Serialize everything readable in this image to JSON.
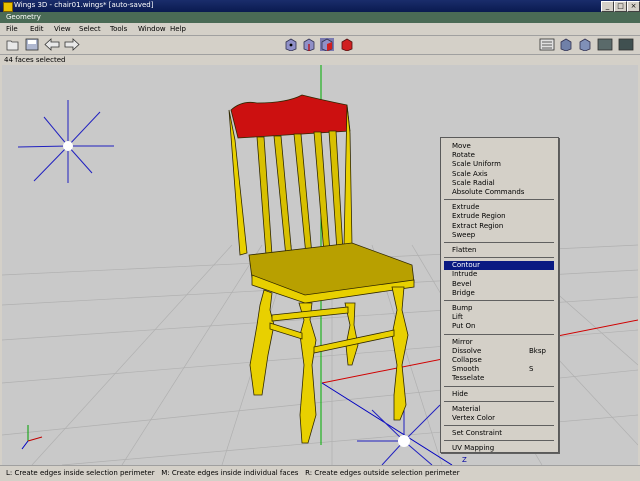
{
  "window": {
    "title": "Wings 3D - chair01.wings* [auto-saved]",
    "controls": {
      "minimize": "_",
      "maximize": "□",
      "close": "×"
    }
  },
  "geometry_bar": {
    "label": "Geometry"
  },
  "menubar": {
    "items": [
      "File",
      "Edit",
      "View",
      "Select",
      "Tools",
      "Window",
      "Help"
    ]
  },
  "toolbar": {
    "left_icons": [
      "open-file-icon",
      "save-icon",
      "undo-arrow-icon",
      "redo-arrow-icon"
    ],
    "mode_icons": [
      "vertex-mode-icon",
      "edge-mode-icon",
      "face-mode-icon",
      "body-mode-icon"
    ],
    "right_icons": [
      "orthographic-icon",
      "smooth-shade-icon",
      "wireframe-icon",
      "ground-plane-icon",
      "axes-icon"
    ]
  },
  "status": {
    "selection": "44 faces selected"
  },
  "context_menu": {
    "groups": [
      [
        {
          "label": "Move"
        },
        {
          "label": "Rotate"
        },
        {
          "label": "Scale Uniform"
        },
        {
          "label": "Scale Axis"
        },
        {
          "label": "Scale Radial"
        },
        {
          "label": "Absolute Commands"
        }
      ],
      [
        {
          "label": "Extrude"
        },
        {
          "label": "Extrude Region"
        },
        {
          "label": "Extract Region"
        },
        {
          "label": "Sweep"
        }
      ],
      [
        {
          "label": "Flatten"
        }
      ],
      [
        {
          "label": "Contour",
          "selected": true
        },
        {
          "label": "Intrude"
        },
        {
          "label": "Bevel"
        },
        {
          "label": "Bridge"
        }
      ],
      [
        {
          "label": "Bump"
        },
        {
          "label": "Lift"
        },
        {
          "label": "Put On"
        }
      ],
      [
        {
          "label": "Mirror"
        },
        {
          "label": "Dissolve",
          "shortcut": "Bksp"
        },
        {
          "label": "Collapse"
        },
        {
          "label": "Smooth",
          "shortcut": "S"
        },
        {
          "label": "Tesselate"
        }
      ],
      [
        {
          "label": "Hide"
        }
      ],
      [
        {
          "label": "Material"
        },
        {
          "label": "Vertex Color"
        }
      ],
      [
        {
          "label": "Set Constraint"
        }
      ],
      [
        {
          "label": "UV Mapping"
        }
      ]
    ]
  },
  "hint_bar": {
    "text": "L: Create edges inside selection perimeter   M: Create edges inside individual faces   R: Create edges outside selection perimeter"
  },
  "viewport": {
    "axis_label": "Z"
  },
  "colors": {
    "selected_faces": "#cc1010",
    "chair": "#e8d000",
    "menu_highlight": "#0a1a82",
    "y_axis": "#00c000",
    "x_axis": "#d00000",
    "z_axis": "#0000c0"
  }
}
